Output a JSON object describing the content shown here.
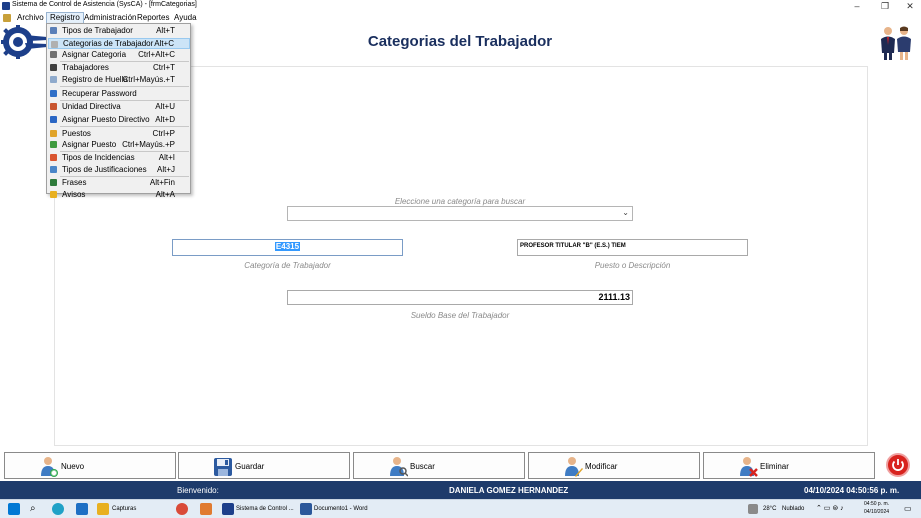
{
  "window": {
    "title": "Sistema de Control de Asistencia (SysCA) - [frmCategorias]"
  },
  "menubar": [
    {
      "label": "Archivo"
    },
    {
      "label": "Registro"
    },
    {
      "label": "Administración"
    },
    {
      "label": "Reportes"
    },
    {
      "label": "Ayuda"
    }
  ],
  "registro_menu": [
    {
      "label": "Tipos de Trabajador",
      "shortcut": "Alt+T",
      "icon": "users-icon",
      "color": "#5a7fb8"
    },
    {
      "label": "Categorias de Trabajador",
      "shortcut": "Alt+C",
      "icon": "person-icon",
      "color": "#b0b0b0",
      "highlighted": true
    },
    {
      "label": "Asignar Categoria",
      "shortcut": "Ctrl+Alt+C",
      "icon": "assign-icon",
      "color": "#707070"
    },
    {
      "label": "Trabajadores",
      "shortcut": "Ctrl+T",
      "icon": "workers-icon",
      "color": "#404040"
    },
    {
      "label": "Registro de Huella",
      "shortcut": "Ctrl+Mayús.+T",
      "icon": "fingerprint-icon",
      "color": "#8faacc"
    },
    {
      "label": "Recuperar Password",
      "shortcut": "",
      "icon": "key-icon",
      "color": "#2f6fc7"
    },
    {
      "label": "Unidad Directiva",
      "shortcut": "Alt+U",
      "icon": "building-icon",
      "color": "#c9552f"
    },
    {
      "label": "Asignar Puesto Directivo",
      "shortcut": "Alt+D",
      "icon": "flag-icon",
      "color": "#2a66c4"
    },
    {
      "label": "Puestos",
      "shortcut": "Ctrl+P",
      "icon": "badge-icon",
      "color": "#e0a42a"
    },
    {
      "label": "Asignar Puesto",
      "shortcut": "Ctrl+Mayús.+P",
      "icon": "flag-green-icon",
      "color": "#3f9b3f"
    },
    {
      "label": "Tipos de Incidencias",
      "shortcut": "Alt+I",
      "icon": "incident-icon",
      "color": "#d9542f"
    },
    {
      "label": "Tipos de Justificaciones",
      "shortcut": "Alt+J",
      "icon": "justify-icon",
      "color": "#4a86c8"
    },
    {
      "label": "Frases",
      "shortcut": "Alt+Fin",
      "icon": "quote-icon",
      "color": "#2d7a3a"
    },
    {
      "label": "Avisos",
      "shortcut": "Alt+A",
      "icon": "notice-icon",
      "color": "#e8b020"
    }
  ],
  "page_title": "Categorias del Trabajador",
  "form": {
    "search_caption": "Eleccione una categoría para buscar",
    "search_value": "",
    "category_value": "E4315",
    "category_caption": "Categoría de Trabajador",
    "description_value": "PROFESOR TITULAR \"B\" (E.S.) TIEM",
    "description_caption": "Puesto o Descripción",
    "salary_value": "2111.13",
    "salary_caption": "Sueldo Base del Trabajador"
  },
  "buttons": {
    "nuevo": "Nuevo",
    "guardar": "Guardar",
    "buscar": "Buscar",
    "modificar": "Modificar",
    "eliminar": "Eliminar"
  },
  "statusbar": {
    "welcome": "Bienvenido:",
    "user": "DANIELA GOMEZ HERNANDEZ",
    "datetime": "04/10/2024 04:50:56 p. m."
  },
  "taskbar": {
    "capturas": "Capturas",
    "app": "Sistema de Control ...",
    "word": "Documento1 - Word",
    "temp": "28°C",
    "weather": "Nublado",
    "time": "04:50 p. m.",
    "date": "04/10/2024"
  },
  "colors": {
    "title": "#1a2f5e",
    "statusbar": "#1e3b6b",
    "highlight": "#3399ff",
    "power": "#d8231e"
  }
}
